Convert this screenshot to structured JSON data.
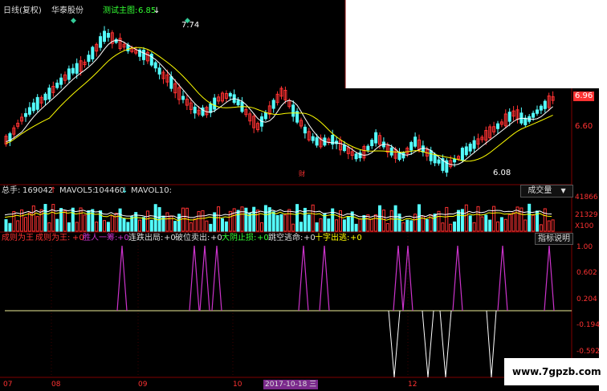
{
  "header": {
    "title": "日线(复权)",
    "stock": "华泰股份",
    "indicator_label": "测试主图:",
    "indicator_value": "6.85",
    "indicator_arrow": "↓"
  },
  "main_chart": {
    "high_label": "7.74",
    "low_label": "6.08",
    "fin_mark": "财",
    "price_axis": [
      "6.96",
      "6.60"
    ]
  },
  "volume_panel": {
    "total_label": "总手:",
    "total_value": "169042",
    "total_arrow": "↑",
    "mavol5_label": "MAVOL5:",
    "mavol5_value": "104460",
    "mavol5_arrow": "↓",
    "mavol10_label": "MAVOL10:",
    "dropdown_label": "成交量",
    "axis": [
      "41866",
      "21329",
      "X100"
    ]
  },
  "signal_panel": {
    "items": [
      {
        "name": "成则为王",
        "value": ""
      },
      {
        "name": "成则为王:",
        "value": "+0"
      },
      {
        "name": "胜人一筹:",
        "value": "+0"
      },
      {
        "name": "连跌出局:",
        "value": "+0"
      },
      {
        "name": "破位卖出:",
        "value": "+0"
      },
      {
        "name": "大阴止损:",
        "value": "+0"
      },
      {
        "name": "跳空逃命:",
        "value": "+0"
      },
      {
        "name": "十字出逃:",
        "value": "+0"
      }
    ],
    "help_button": "指标说明",
    "axis": [
      "1.00",
      "0.602",
      "0.204",
      "-0.194",
      "-0.592"
    ]
  },
  "time_axis": {
    "labels": [
      "07",
      "08",
      "09",
      "10",
      "12"
    ],
    "cursor_date": "2017-10-18 三"
  },
  "watermark": "www.7gpzb.com",
  "colors": {
    "up": "#ff3232",
    "down": "#54ffff",
    "ma_white": "#ffffff",
    "ma_yellow": "#ffff00",
    "signal_magenta": "#cc33cc",
    "axis_red": "#c00000"
  }
}
